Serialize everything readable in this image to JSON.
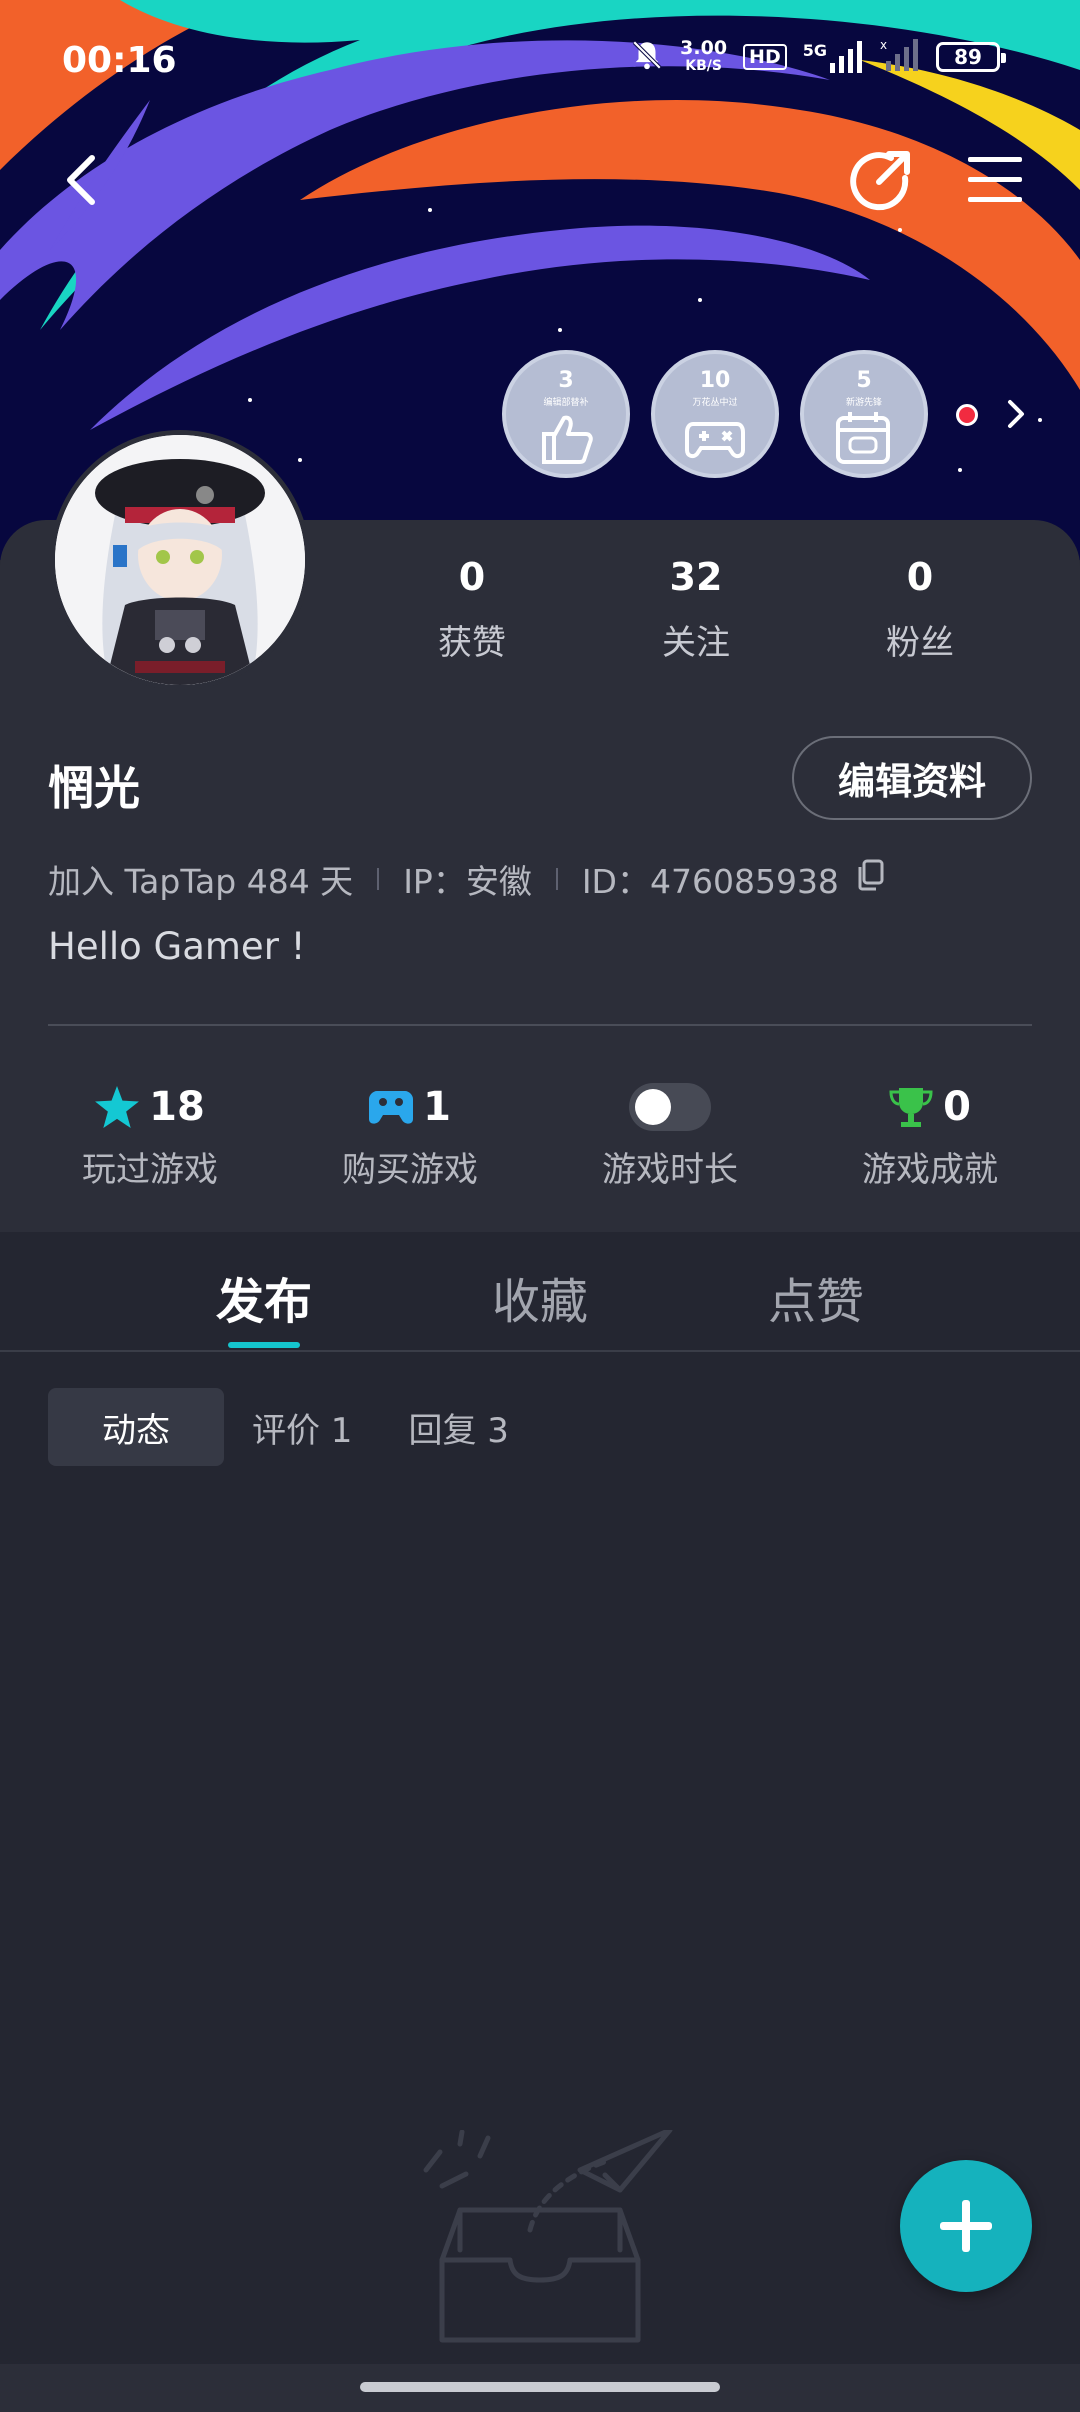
{
  "status_bar": {
    "time": "00:16",
    "net_speed_value": "3.00",
    "net_speed_unit": "KB/S",
    "hd": "HD",
    "signal_type": "5G",
    "battery": "89"
  },
  "badges": [
    {
      "num": "3",
      "sub": "编辑部替补"
    },
    {
      "num": "10",
      "sub": "万花丛中过"
    },
    {
      "num": "5",
      "sub": "新游先锋"
    }
  ],
  "stats": [
    {
      "num": "0",
      "label": "获赞"
    },
    {
      "num": "32",
      "label": "关注"
    },
    {
      "num": "0",
      "label": "粉丝"
    }
  ],
  "profile": {
    "name": "惘光",
    "edit_label": "编辑资料",
    "joined": "加入 TapTap 484 天",
    "ip": "IP：安徽",
    "id": "ID：476085938",
    "bio": "Hello Gamer !"
  },
  "game_stats": [
    {
      "value": "18",
      "label": "玩过游戏",
      "icon": "star-icon"
    },
    {
      "value": "1",
      "label": "购买游戏",
      "icon": "gamepad-icon"
    },
    {
      "value": "",
      "label": "游戏时长",
      "icon": "toggle"
    },
    {
      "value": "0",
      "label": "游戏成就",
      "icon": "trophy-icon"
    }
  ],
  "tabs": [
    "发布",
    "收藏",
    "点赞"
  ],
  "subtabs": [
    "动态",
    "评价 1",
    "回复 3"
  ],
  "colors": {
    "accent": "#15b2bd",
    "star": "#14c8d3",
    "gamepad": "#2aa7ec",
    "trophy": "#3ac24a",
    "badge_dot": "#f12b40"
  }
}
